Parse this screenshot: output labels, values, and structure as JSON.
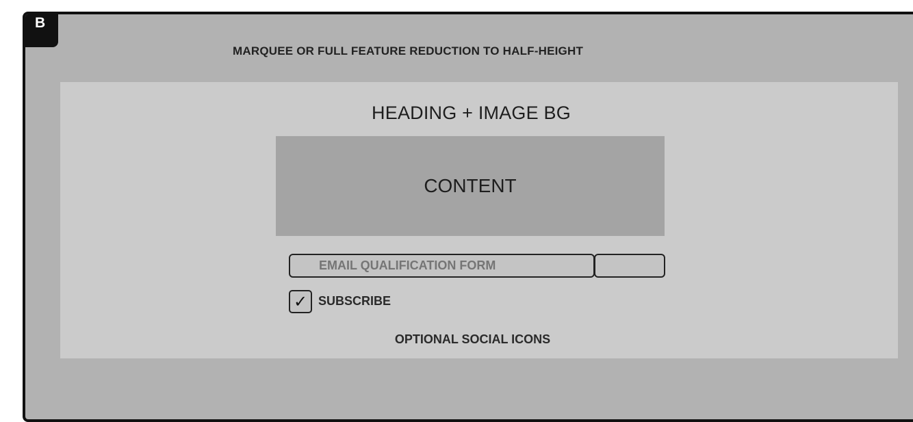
{
  "frame": {
    "badge": "B",
    "title": "MARQUEE OR FULL FEATURE REDUCTION TO HALF-HEIGHT"
  },
  "panel": {
    "heading": "HEADING + IMAGE BG",
    "content": "CONTENT",
    "email_form": {
      "placeholder": "EMAIL QUALIFICATION FORM",
      "value": ""
    },
    "subscribe": {
      "checked": true,
      "check_glyph": "✓",
      "label": "SUBSCRIBE"
    },
    "social": "OPTIONAL SOCIAL ICONS"
  },
  "colors": {
    "frame_bg": "#b2b2b2",
    "frame_border": "#111111",
    "panel_bg": "#cbcbcb",
    "content_bg": "#a4a4a4"
  }
}
